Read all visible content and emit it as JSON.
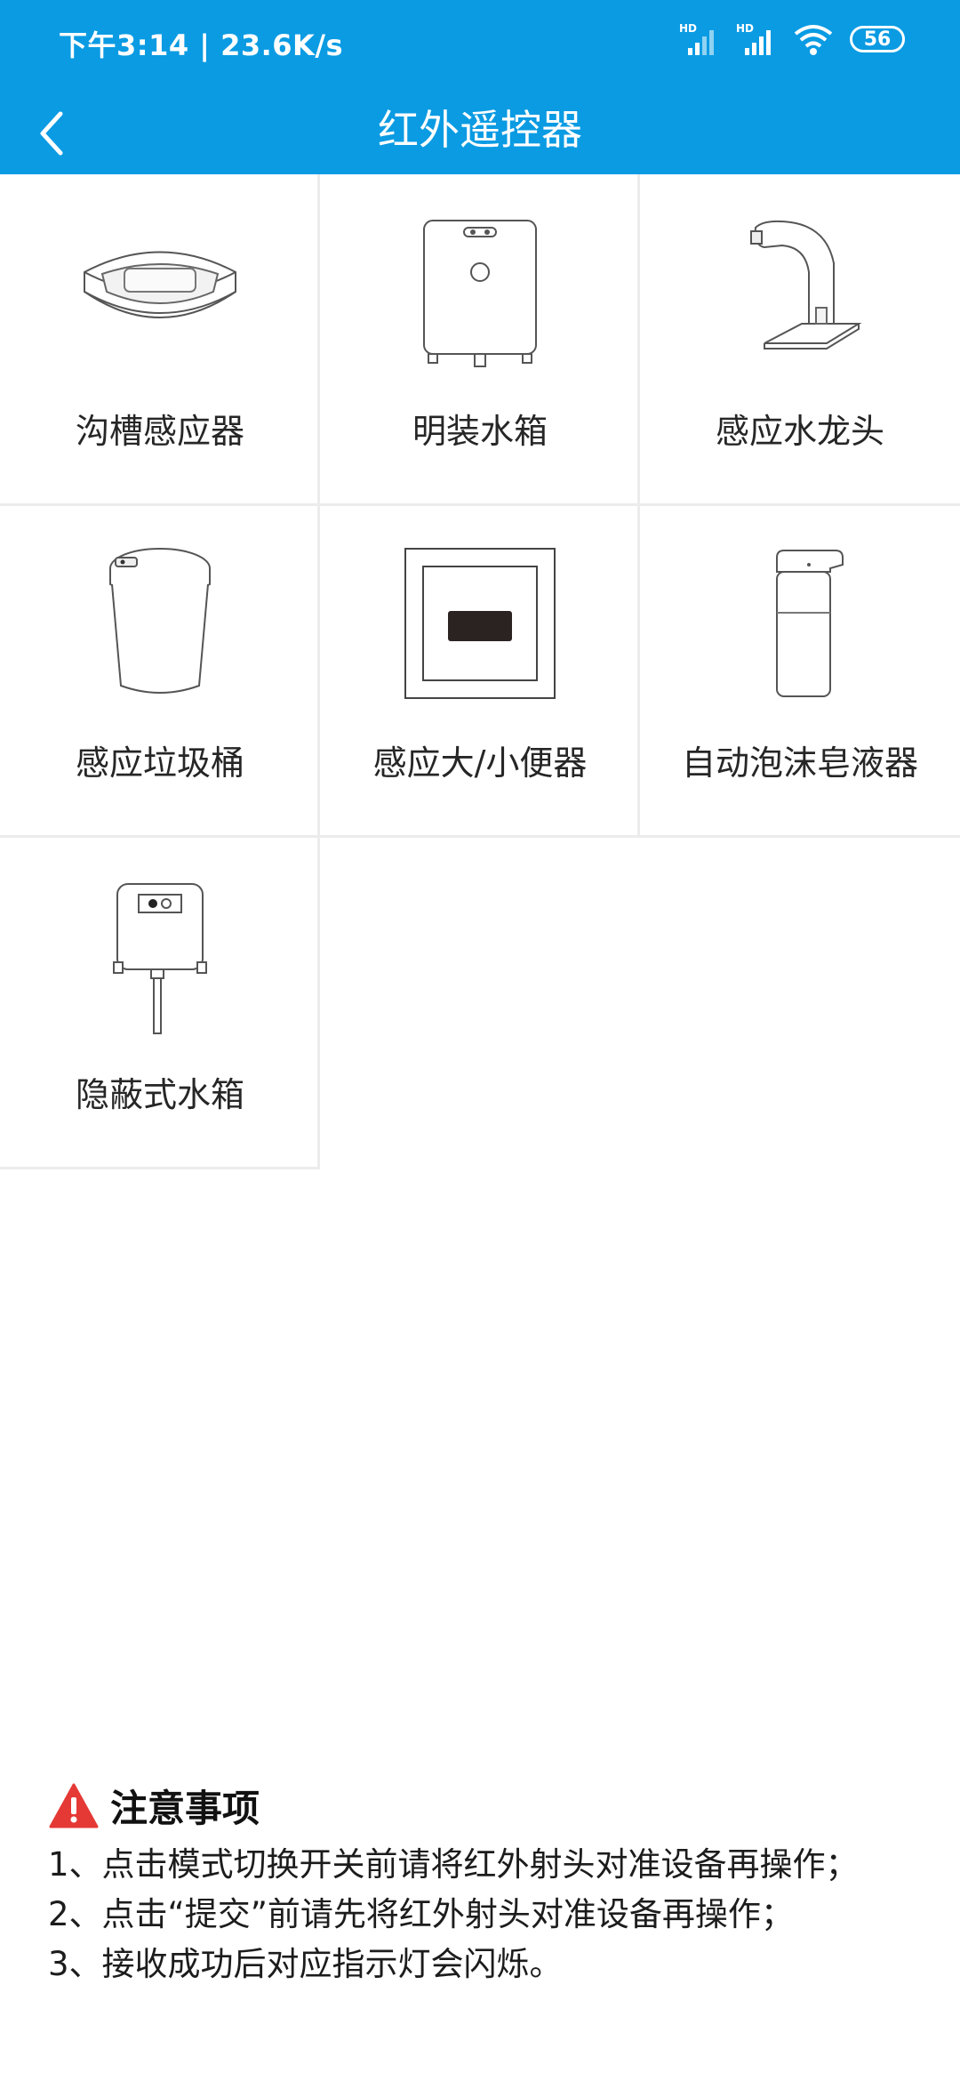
{
  "status_bar": {
    "time_speed": "下午3:14 | 23.6K/s",
    "network_badges": [
      "HD",
      "HD"
    ],
    "battery": "56",
    "icons": [
      "signal-icon",
      "signal-icon",
      "wifi-icon",
      "battery-icon"
    ]
  },
  "header": {
    "title": "红外遥控器",
    "back_icon": "chevron-left-icon",
    "background_color": "#0a9be3"
  },
  "devices": [
    {
      "label": "沟槽感应器",
      "icon": "trough-sensor-icon"
    },
    {
      "label": "明装水箱",
      "icon": "exposed-tank-icon"
    },
    {
      "label": "感应水龙头",
      "icon": "sensor-faucet-icon"
    },
    {
      "label": "感应垃圾桶",
      "icon": "sensor-trashcan-icon"
    },
    {
      "label": "感应大/小便器",
      "icon": "urinal-sensor-icon"
    },
    {
      "label": "自动泡沫皂液器",
      "icon": "soap-dispenser-icon"
    },
    {
      "label": "隐蔽式水箱",
      "icon": "concealed-tank-icon"
    }
  ],
  "notes": {
    "title": "注意事项",
    "warning_icon": "warning-icon",
    "warning_color": "#e53935",
    "lines": [
      "1、点击模式切换开关前请将红外射头对准设备再操作；",
      "2、点击“提交”前请先将红外射头对准设备再操作；",
      "3、接收成功后对应指示灯会闪烁。"
    ]
  }
}
